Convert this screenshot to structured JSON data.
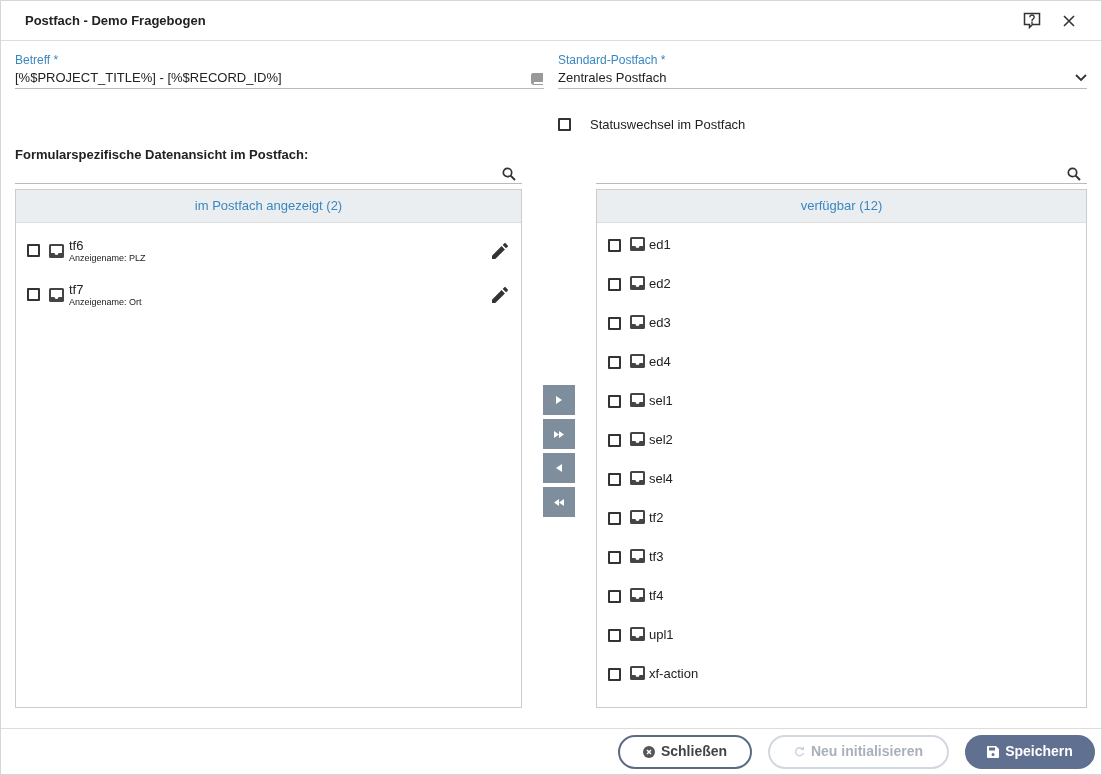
{
  "window": {
    "title": "Postfach - Demo Fragebogen"
  },
  "subject": {
    "label": "Betreff *",
    "value": "[%$PROJECT_TITLE%] - [%$RECORD_ID%]"
  },
  "mailbox": {
    "label": "Standard-Postfach *",
    "value": "Zentrales Postfach"
  },
  "status_change": {
    "label": "Statuswechsel im Postfach",
    "checked": false
  },
  "section_title": "Formularspezifische Datenansicht im Postfach:",
  "shown_list": {
    "header": "im Postfach angezeigt (2)",
    "items": [
      {
        "name": "tf6",
        "caption": "Anzeigename: PLZ",
        "checked": false
      },
      {
        "name": "tf7",
        "caption": "Anzeigename: Ort",
        "checked": false
      }
    ]
  },
  "available_list": {
    "header": "verfügbar (12)",
    "items": [
      {
        "name": "ed1",
        "checked": false
      },
      {
        "name": "ed2",
        "checked": false
      },
      {
        "name": "ed3",
        "checked": false
      },
      {
        "name": "ed4",
        "checked": false
      },
      {
        "name": "sel1",
        "checked": false
      },
      {
        "name": "sel2",
        "checked": false
      },
      {
        "name": "sel4",
        "checked": false
      },
      {
        "name": "tf2",
        "checked": false
      },
      {
        "name": "tf3",
        "checked": false
      },
      {
        "name": "tf4",
        "checked": false
      },
      {
        "name": "upl1",
        "checked": false
      },
      {
        "name": "xf-action",
        "checked": false
      }
    ]
  },
  "footer_buttons": [
    {
      "label": "Schließen",
      "kind": "close",
      "disabled": false
    },
    {
      "label": "Neu initialisieren",
      "kind": "reset",
      "disabled": true
    },
    {
      "label": "Speichern",
      "kind": "save",
      "disabled": false
    }
  ]
}
